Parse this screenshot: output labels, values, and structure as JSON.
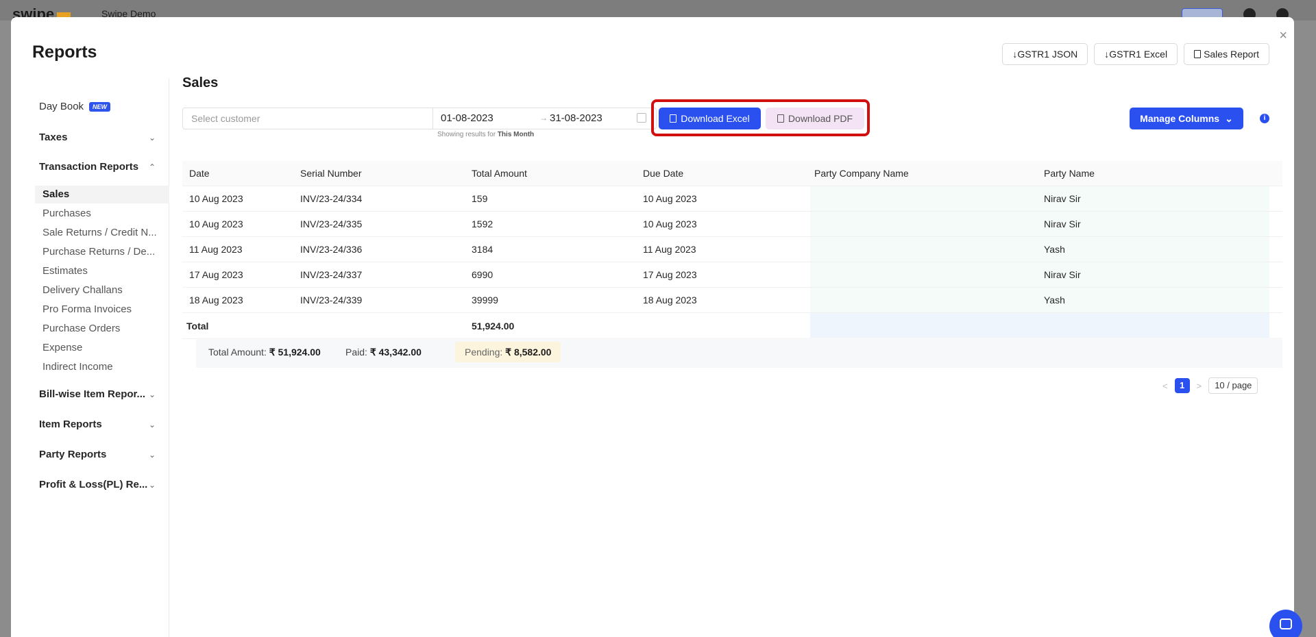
{
  "background": {
    "brand": "swipe",
    "company": "Swipe Demo"
  },
  "modal": {
    "title": "Reports",
    "close": "×"
  },
  "top_actions": [
    {
      "label": "↓GSTR1 JSON"
    },
    {
      "label": "↓GSTR1 Excel"
    },
    {
      "label": "Sales Report"
    }
  ],
  "sidebar": {
    "day_book": "Day Book",
    "new_badge": "NEW",
    "taxes": "Taxes",
    "transaction_reports": "Transaction Reports",
    "sub_items": [
      "Sales",
      "Purchases",
      "Sale Returns / Credit N...",
      "Purchase Returns / De...",
      "Estimates",
      "Delivery Challans",
      "Pro Forma Invoices",
      "Purchase Orders",
      "Expense",
      "Indirect Income"
    ],
    "bill_wise": "Bill-wise Item Repor...",
    "item_reports": "Item Reports",
    "party_reports": "Party Reports",
    "profit_loss": "Profit & Loss(PL) Re..."
  },
  "content": {
    "title": "Sales",
    "customer_placeholder": "Select customer",
    "date_from": "01-08-2023",
    "date_arrow": "→",
    "date_to": "31-08-2023",
    "showing_prefix": "Showing results for",
    "showing_period": "This Month",
    "download_excel": "Download Excel",
    "download_pdf": "Download PDF",
    "manage_columns": "Manage Columns",
    "info": "i"
  },
  "table": {
    "headers": [
      "Date",
      "Serial Number",
      "Total Amount",
      "Due Date",
      "Party Company Name",
      "Party Name"
    ],
    "rows": [
      [
        "10 Aug 2023",
        "INV/23-24/334",
        "159",
        "10 Aug 2023",
        "",
        "Nirav Sir"
      ],
      [
        "10 Aug 2023",
        "INV/23-24/335",
        "1592",
        "10 Aug 2023",
        "",
        "Nirav Sir"
      ],
      [
        "11 Aug 2023",
        "INV/23-24/336",
        "3184",
        "11 Aug 2023",
        "",
        "Yash"
      ],
      [
        "17 Aug 2023",
        "INV/23-24/337",
        "6990",
        "17 Aug 2023",
        "",
        "Nirav Sir"
      ],
      [
        "18 Aug 2023",
        "INV/23-24/339",
        "39999",
        "18 Aug 2023",
        "",
        "Yash"
      ]
    ],
    "total_label": "Total",
    "total_value": "51,924.00"
  },
  "summary": {
    "total_label": "Total Amount:",
    "total_value": "₹ 51,924.00",
    "paid_label": "Paid:",
    "paid_value": "₹ 43,342.00",
    "pending_label": "Pending:",
    "pending_value": "₹ 8,582.00"
  },
  "pagination": {
    "prev": "<",
    "current": "1",
    "next": ">",
    "page_size": "10 / page"
  },
  "colors": {
    "primary": "#2b50f0",
    "highlight": "#d10f0f",
    "pdf_bg": "#f4e3f4",
    "pending_bg": "#fdf4dd"
  }
}
